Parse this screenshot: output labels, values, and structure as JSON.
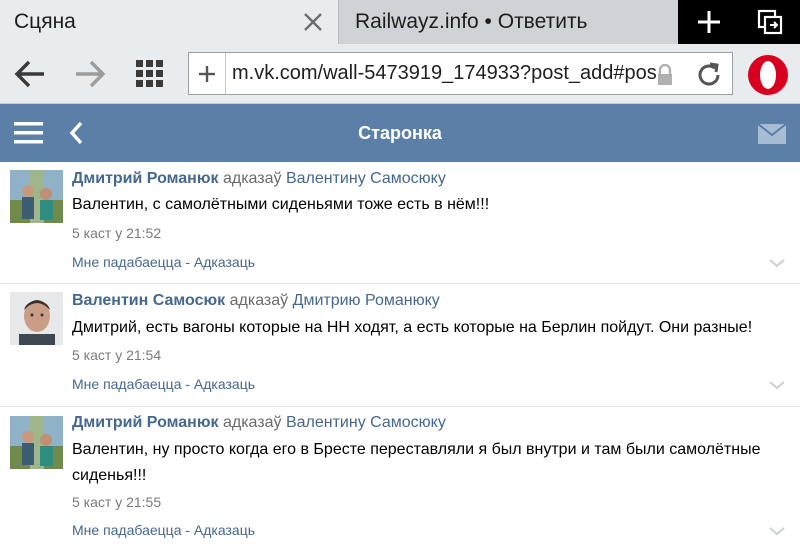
{
  "browser": {
    "tabs": [
      {
        "title": "Сцяна",
        "active": true
      },
      {
        "title": "Railwayz.info • Ответить",
        "active": false
      }
    ],
    "url": "m.vk.com/wall-5473919_174933?post_add#pos",
    "icons": [
      "back-arrow-icon",
      "forward-arrow-icon",
      "grid-icon",
      "plus-icon",
      "lock-icon",
      "reload-icon",
      "opera-logo-icon",
      "new-tab-icon",
      "tabs-icon",
      "close-icon"
    ]
  },
  "header": {
    "title": "Старонка",
    "icons": [
      "menu-icon",
      "chevron-left-icon",
      "mail-icon"
    ],
    "color": "#5b7fa6"
  },
  "comments": [
    {
      "author": "Дмитрий Романюк",
      "reply_verb": "адказаў",
      "reply_to": "Валентину Самосюку",
      "text": "Валентин, с самолётными сиденьями тоже есть в нём!!!",
      "time": "5 каст у 21:52",
      "actions": "Мне падабаецца - Адказаць"
    },
    {
      "author": "Валентин Самосюк",
      "reply_verb": "адказаў",
      "reply_to": "Дмитрию Романюку",
      "text": "Дмитрий, есть вагоны которые на НН ходят, а есть которые на Берлин пойдут. Они разные!",
      "time": "5 каст у 21:54",
      "actions": "Мне падабаецца - Адказаць"
    },
    {
      "author": "Дмитрий Романюк",
      "reply_verb": "адказаў",
      "reply_to": "Валентину Самосюку",
      "text": "Валентин, ну просто когда его в Бресте переставляли я был внутри и там были самолётные сиденья!!!",
      "time": "5 каст у 21:55",
      "actions": "Мне падабаецца - Адказаць"
    }
  ],
  "colors": {
    "link": "#45688e",
    "toolbar": "#e9ecef",
    "opera_red": "#d8001e"
  }
}
